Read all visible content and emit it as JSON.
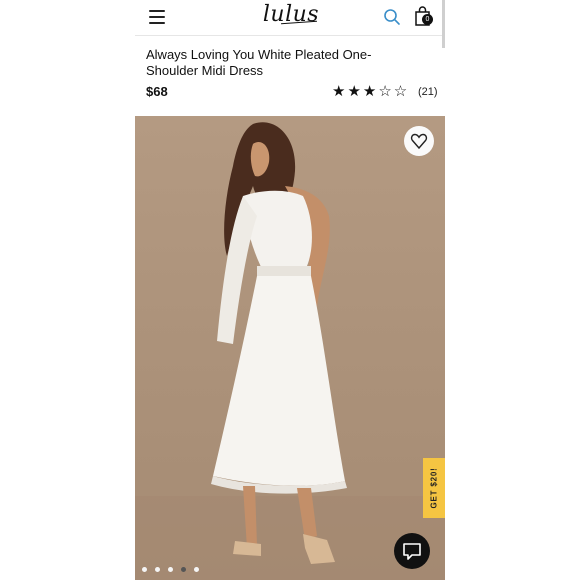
{
  "header": {
    "logo_text": "lulus",
    "cart_count": "0",
    "icons": [
      "hamburger-menu-icon",
      "search-icon",
      "shopping-bag-icon"
    ]
  },
  "product": {
    "title": "Always Loving You White Pleated One-Shoulder Midi Dress",
    "price": "$68",
    "rating": 3,
    "rating_max": 5,
    "stars_display": "★★★☆☆",
    "review_count": "(21)"
  },
  "gallery": {
    "image_count": 5,
    "active_index": 3,
    "wishlist_icon": "heart-icon",
    "promo_label": "GET $20!",
    "chat_icon": "chat-bubble-icon"
  },
  "colors": {
    "background_photo": "#ac927a",
    "promo_tab": "#f5c542",
    "search_icon": "#3a8ec9",
    "text": "#111111"
  }
}
